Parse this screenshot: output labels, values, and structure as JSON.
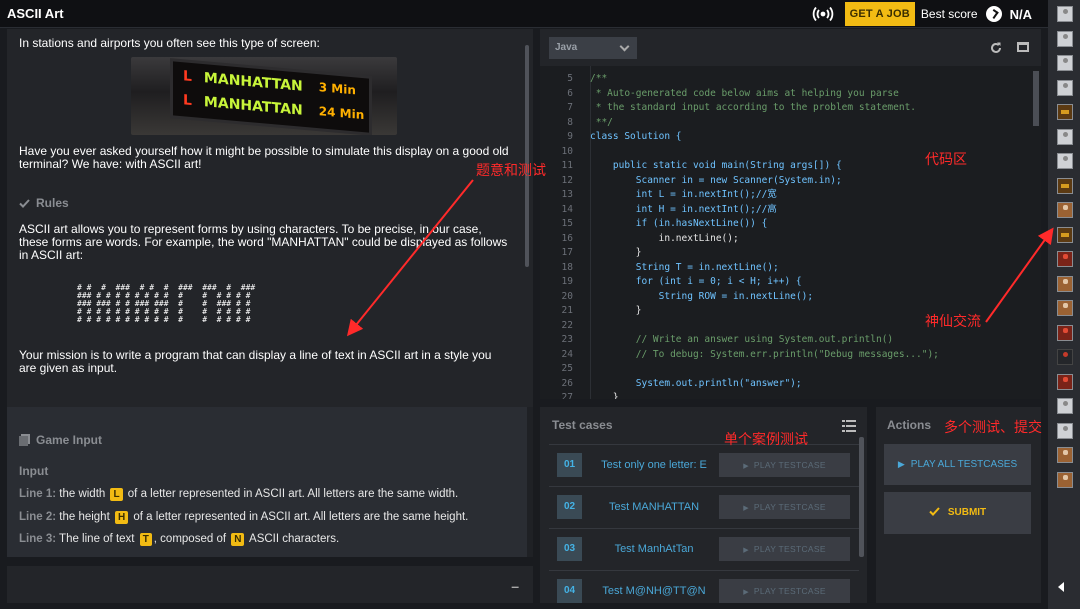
{
  "app": {
    "title": "ASCII Art"
  },
  "topbar": {
    "job_label": "GET A JOB",
    "best_score_label": "Best score",
    "best_score_value": "N/A"
  },
  "statement": {
    "intro": "In stations and airports you often see this type of screen:",
    "board": {
      "rows": [
        {
          "letter": "L",
          "dest": "MANHATTAN",
          "min": "3 Min"
        },
        {
          "letter": "L",
          "dest": "MANHATTAN",
          "min": "24 Min"
        }
      ]
    },
    "question": "Have you ever asked yourself how it might be possible to simulate this display on a good old terminal? We have: with ASCII art!",
    "rules_title": "Rules",
    "rules_text": "ASCII art allows you to represent forms by using characters. To be precise, in our case, these forms are words. For example, the word \"MANHATTAN\" could be displayed as follows in ASCII art:",
    "ascii_art": "# #  #  ###  # #  #  ###  ###  #  ###\n### # # # # # # # #  #    #  # # # #\n### ### # # ### ###  #    #  ### # #\n# # # # # # # # # #  #    #  # # # #\n# # # # # # # # # #  #    #  # # # #",
    "mission": "Your mission is to write a program that can display a line of text in ASCII art in a style you are given as input."
  },
  "game_input": {
    "title": "Game Input",
    "input_label": "Input",
    "lines": [
      {
        "label": "Line 1:",
        "pre": " the width ",
        "var": "L",
        "post": " of a letter represented in ASCII art. All letters are the same width."
      },
      {
        "label": "Line 2:",
        "pre": " the height ",
        "var": "H",
        "post": " of a letter represented in ASCII art. All letters are the same height."
      },
      {
        "label": "Line 3:",
        "pre": " The line of text ",
        "var": "T",
        "post": ", composed of ",
        "var2": "N",
        "post2": " ASCII characters."
      }
    ]
  },
  "editor": {
    "language": "Java",
    "lines": [
      {
        "n": "5",
        "t": "/**",
        "c": "cm",
        "i": 0
      },
      {
        "n": "6",
        "t": " * Auto-generated code below aims at helping you parse",
        "c": "cm",
        "i": 0
      },
      {
        "n": "7",
        "t": " * the standard input according to the problem statement.",
        "c": "cm",
        "i": 0
      },
      {
        "n": "8",
        "t": " **/",
        "c": "cm",
        "i": 0
      },
      {
        "n": "9",
        "t": "class Solution {",
        "c": "mix",
        "i": 0
      },
      {
        "n": "10",
        "t": "",
        "c": "tx",
        "i": 0
      },
      {
        "n": "11",
        "t": "    public static void main(String args[]) {",
        "c": "mix",
        "i": 0
      },
      {
        "n": "12",
        "t": "        Scanner in = new Scanner(System.in);",
        "c": "mix",
        "i": 0
      },
      {
        "n": "13",
        "t": "        int L = in.nextInt();//宽",
        "c": "mix",
        "i": 0
      },
      {
        "n": "14",
        "t": "        int H = in.nextInt();//高",
        "c": "mix",
        "i": 0
      },
      {
        "n": "15",
        "t": "        if (in.hasNextLine()) {",
        "c": "mix",
        "i": 0
      },
      {
        "n": "16",
        "t": "            in.nextLine();",
        "c": "tx",
        "i": 0
      },
      {
        "n": "17",
        "t": "        }",
        "c": "tx",
        "i": 0
      },
      {
        "n": "18",
        "t": "        String T = in.nextLine();",
        "c": "mix",
        "i": 0
      },
      {
        "n": "19",
        "t": "        for (int i = 0; i < H; i++) {",
        "c": "mix",
        "i": 0
      },
      {
        "n": "20",
        "t": "            String ROW = in.nextLine();",
        "c": "mix",
        "i": 0
      },
      {
        "n": "21",
        "t": "        }",
        "c": "tx",
        "i": 0
      },
      {
        "n": "22",
        "t": "",
        "c": "tx",
        "i": 0
      },
      {
        "n": "23",
        "t": "        // Write an answer using System.out.println()",
        "c": "cm",
        "i": 0
      },
      {
        "n": "24",
        "t": "        // To debug: System.err.println(\"Debug messages...\");",
        "c": "cm",
        "i": 0
      },
      {
        "n": "25",
        "t": "",
        "c": "tx",
        "i": 0
      },
      {
        "n": "26",
        "t": "        System.out.println(\"answer\");",
        "c": "mix",
        "i": 0
      },
      {
        "n": "27",
        "t": "    }",
        "c": "tx",
        "i": 0
      }
    ]
  },
  "testcases": {
    "title": "Test cases",
    "play_label": "PLAY TESTCASE",
    "items": [
      {
        "num": "01",
        "name": "Test only one letter: E"
      },
      {
        "num": "02",
        "name": "Test MANHATTAN"
      },
      {
        "num": "03",
        "name": "Test ManhAtTan"
      },
      {
        "num": "04",
        "name": "Test M@NH@TT@N"
      }
    ]
  },
  "actions": {
    "title": "Actions",
    "play_all_label": "PLAY ALL TESTCASES",
    "submit_label": "SUBMIT"
  },
  "annotations": {
    "statement": "题意和测试",
    "code": "代码区",
    "chat": "神仙交流",
    "single": "单个案例测试",
    "multi": "多个测试、提交"
  },
  "colors": {
    "accent": "#f2bb13",
    "link": "#4aa8d8",
    "annotation": "#ff2a2a",
    "bg": "#191b1f"
  },
  "sidebar": {
    "avatars": [
      "user",
      "user",
      "user",
      "user",
      "pixel",
      "user",
      "user",
      "pixel",
      "fox",
      "pixel",
      "red",
      "fox",
      "fox",
      "red",
      "dark",
      "red",
      "user",
      "user",
      "fox",
      "fox"
    ]
  }
}
